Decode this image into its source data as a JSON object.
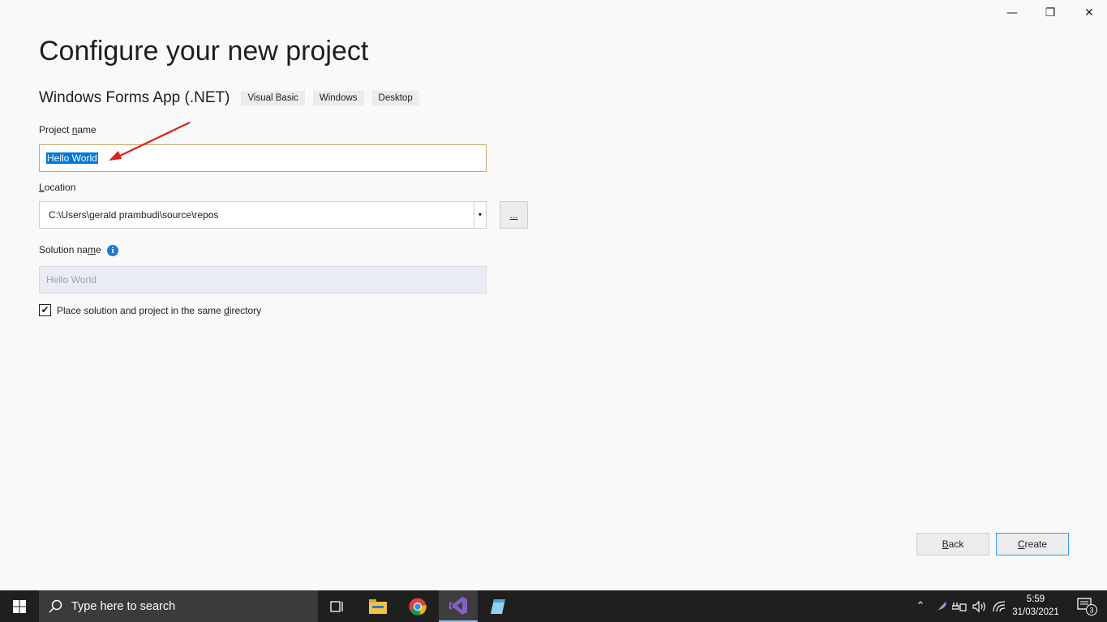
{
  "window": {
    "minimize_glyph": "—",
    "restore_glyph": "❐",
    "close_glyph": "✕"
  },
  "page": {
    "title": "Configure your new project",
    "template_name": "Windows Forms App (.NET)",
    "tags": [
      "Visual Basic",
      "Windows",
      "Desktop"
    ]
  },
  "form": {
    "project_name_label_pre": "Project ",
    "project_name_label_accel": "n",
    "project_name_label_post": "ame",
    "project_name_value": "Hello World",
    "location_label_accel": "L",
    "location_label_post": "ocation",
    "location_value": "C:\\Users\\gerald prambudi\\source\\repos",
    "browse_label": "...",
    "solution_name_label_pre": "Solution na",
    "solution_name_label_accel": "m",
    "solution_name_label_post": "e",
    "solution_name_value": "Hello World",
    "same_dir_checked": true,
    "same_dir_label_pre": "Place solution and project in the same ",
    "same_dir_label_accel": "d",
    "same_dir_label_post": "irectory",
    "info_glyph": "i",
    "checkmark": "✔"
  },
  "buttons": {
    "back_accel": "B",
    "back_post": "ack",
    "create_accel": "C",
    "create_post": "reate"
  },
  "annotation": {
    "color": "#e0201b"
  },
  "taskbar": {
    "search_placeholder": "Type here to search",
    "time": "5:59",
    "date": "31/03/2021",
    "notification_count": "3"
  }
}
